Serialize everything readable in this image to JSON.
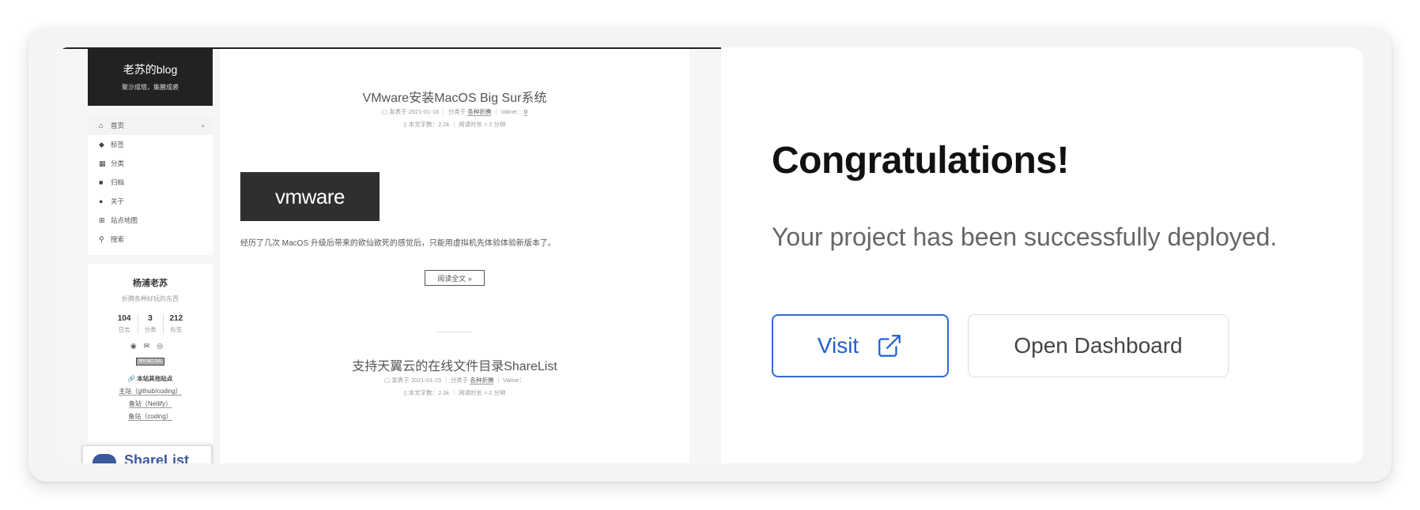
{
  "screenshot": {
    "site_title": "老苏的blog",
    "site_subtitle": "聚沙成塔，集腋成裘",
    "menu": [
      {
        "label": "首页",
        "icon": "home-icon",
        "glyph": "⌂",
        "active": true
      },
      {
        "label": "标签",
        "icon": "tags-icon",
        "glyph": "◆"
      },
      {
        "label": "分类",
        "icon": "grid-icon",
        "glyph": "▦"
      },
      {
        "label": "归档",
        "icon": "archive-icon",
        "glyph": "■"
      },
      {
        "label": "关于",
        "icon": "user-icon",
        "glyph": "●"
      },
      {
        "label": "站点地图",
        "icon": "sitemap-icon",
        "glyph": "⊞"
      },
      {
        "label": "搜索",
        "icon": "search-icon",
        "glyph": "⚲"
      }
    ],
    "author": {
      "name": "杨浦老苏",
      "description": "折腾各种好玩的东西",
      "stats": [
        {
          "num": "104",
          "label": "日志"
        },
        {
          "num": "3",
          "label": "分类"
        },
        {
          "num": "212",
          "label": "标签"
        }
      ],
      "social_icons": [
        "github-icon",
        "mail-icon",
        "weibo-icon"
      ],
      "license": "BY-NC-SA",
      "links_title": "本站其他站点",
      "links": [
        "主站（github/coding）",
        "备站（Netlify）",
        "备站（coding）"
      ]
    },
    "posts": [
      {
        "title": "VMware安装MacOS Big Sur系统",
        "meta1_prefix": "发表于 2021-01-18 ｜ 分类于",
        "category": "各种折腾",
        "meta1_suffix": "｜ Valine：",
        "comments": "0",
        "meta2": "本文字数：2.2k ｜ 阅读时长 ≈ 2 分钟",
        "image_text": "vmware",
        "excerpt": "经历了几次 MacOS 升级后带来的欲仙欲死的感觉后，只能用虚拟机先体验体验新版本了。",
        "read_more": "阅读全文 »"
      },
      {
        "title": "支持天翼云的在线文件目录ShareList",
        "meta1_prefix": "发表于 2021-01-15 ｜ 分类于",
        "category": "各种折腾",
        "meta1_suffix": "｜ Valine：",
        "meta2": "本文字数：2.3k ｜ 阅读时长 ≈ 2 分钟",
        "image_text": "ShareList"
      }
    ]
  },
  "panel": {
    "heading": "Congratulations!",
    "subtitle": "Your project has been successfully deployed.",
    "visit_label": "Visit",
    "dashboard_label": "Open Dashboard"
  },
  "colors": {
    "accent": "#1f5fd6",
    "panel_bg": "#f3f4f5",
    "blog_header": "#222222"
  }
}
